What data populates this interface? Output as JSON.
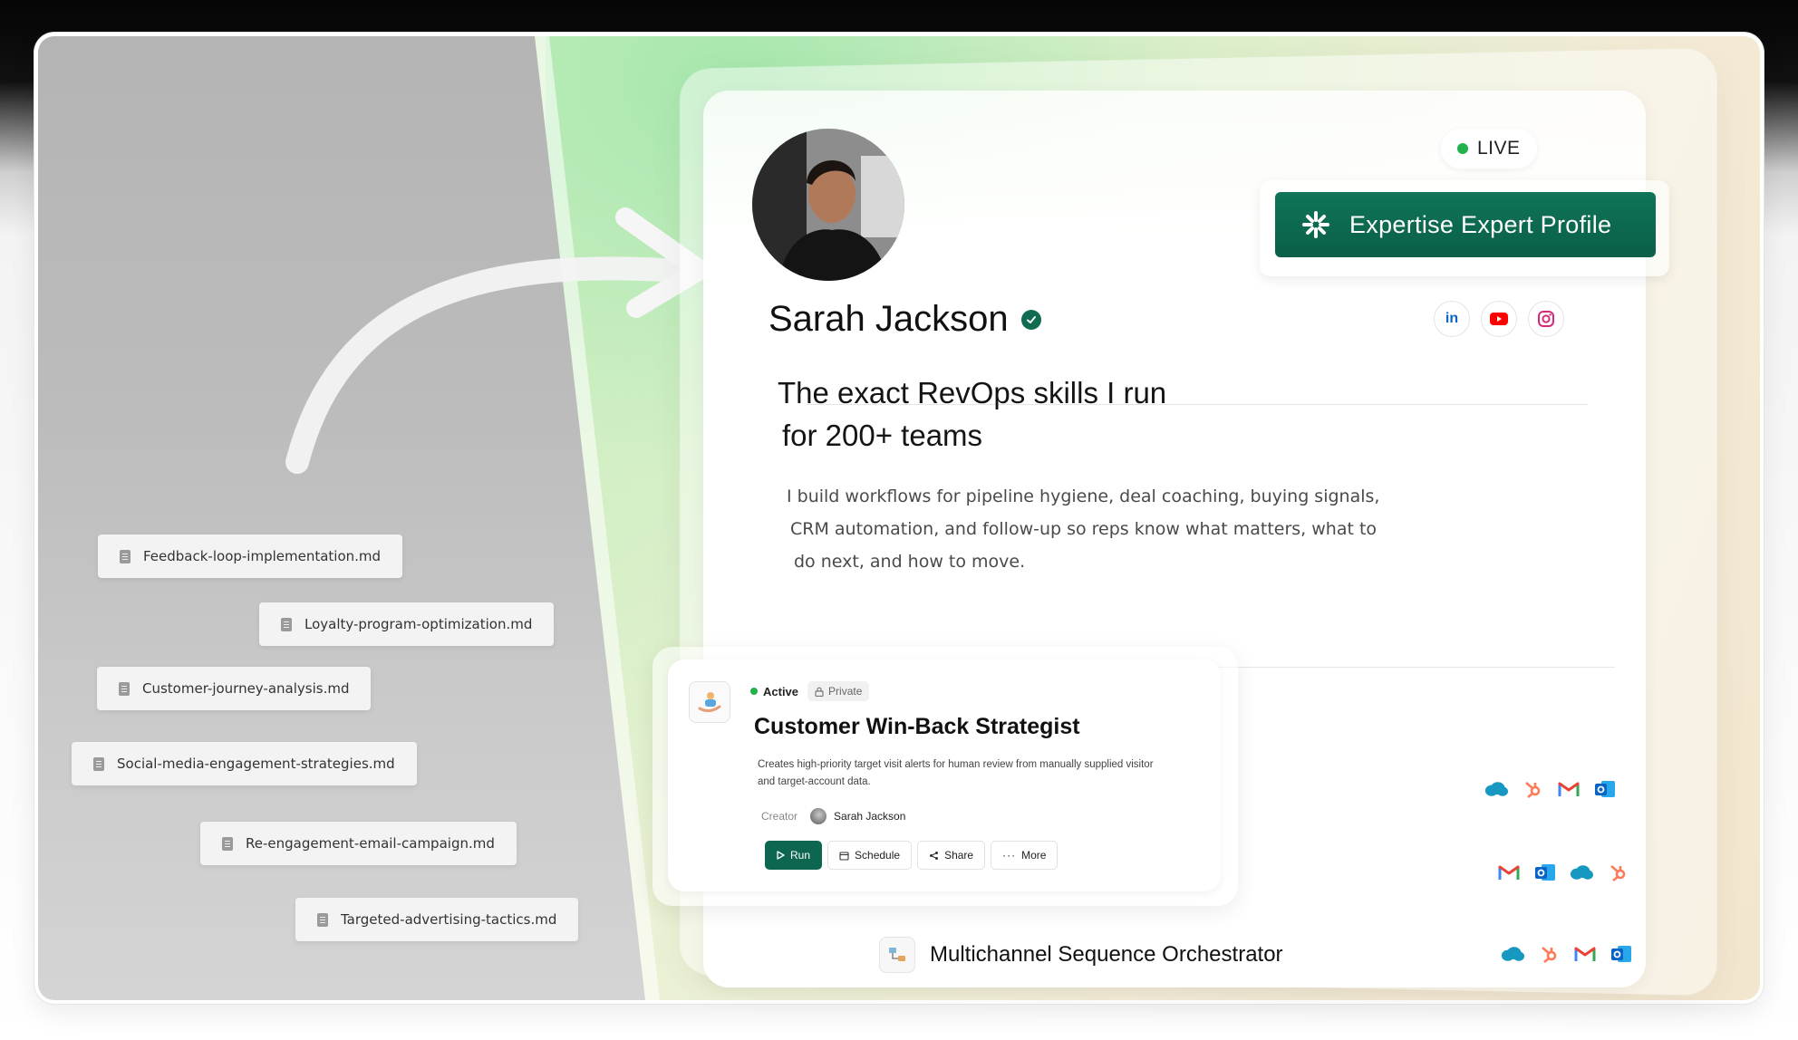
{
  "files": [
    "Feedback-loop-implementation.md",
    "Loyalty-program-optimization.md",
    "Customer-journey-analysis.md",
    "Social-media-engagement-strategies.md",
    "Re-engagement-email-campaign.md",
    "Targeted-advertising-tactics.md"
  ],
  "profile": {
    "live_label": "LIVE",
    "expert_label": "Expertise Expert Profile",
    "name": "Sarah Jackson",
    "socials": [
      "linkedin-icon",
      "youtube-icon",
      "instagram-icon"
    ],
    "headline": [
      "The exact RevOps skills I run",
      "for 200+ teams"
    ],
    "description": [
      "I build workflows for pipeline hygiene, deal coaching, buying signals,",
      "CRM automation, and follow-up so reps know what matters, what to",
      "do next, and how to move."
    ]
  },
  "skill_card": {
    "status": "Active",
    "visibility": "Private",
    "title": "Customer Win-Back Strategist",
    "description": [
      "Creates high-priority target visit alerts for human review from manually supplied visitor",
      "and target-account data."
    ],
    "creator_label": "Creator",
    "creator_name": "Sarah Jackson",
    "actions": {
      "run": "Run",
      "schedule": "Schedule",
      "share": "Share",
      "more": "More"
    }
  },
  "skills_list": [
    {
      "title": "",
      "tools": [
        "salesforce-icon",
        "hubspot-icon",
        "gmail-icon",
        "outlook-icon"
      ]
    },
    {
      "title": "",
      "tools": [
        "gmail-icon",
        "outlook-icon",
        "salesforce-icon",
        "hubspot-icon"
      ]
    },
    {
      "title": "Multichannel Sequence Orchestrator",
      "tools": [
        "salesforce-icon",
        "hubspot-icon",
        "gmail-icon",
        "outlook-icon"
      ]
    }
  ],
  "colors": {
    "brand_green": "#0d6650",
    "live_green": "#22b24c",
    "salesforce": "#1798c1",
    "hubspot": "#ff7a59",
    "outlook": "#0a64c8"
  }
}
